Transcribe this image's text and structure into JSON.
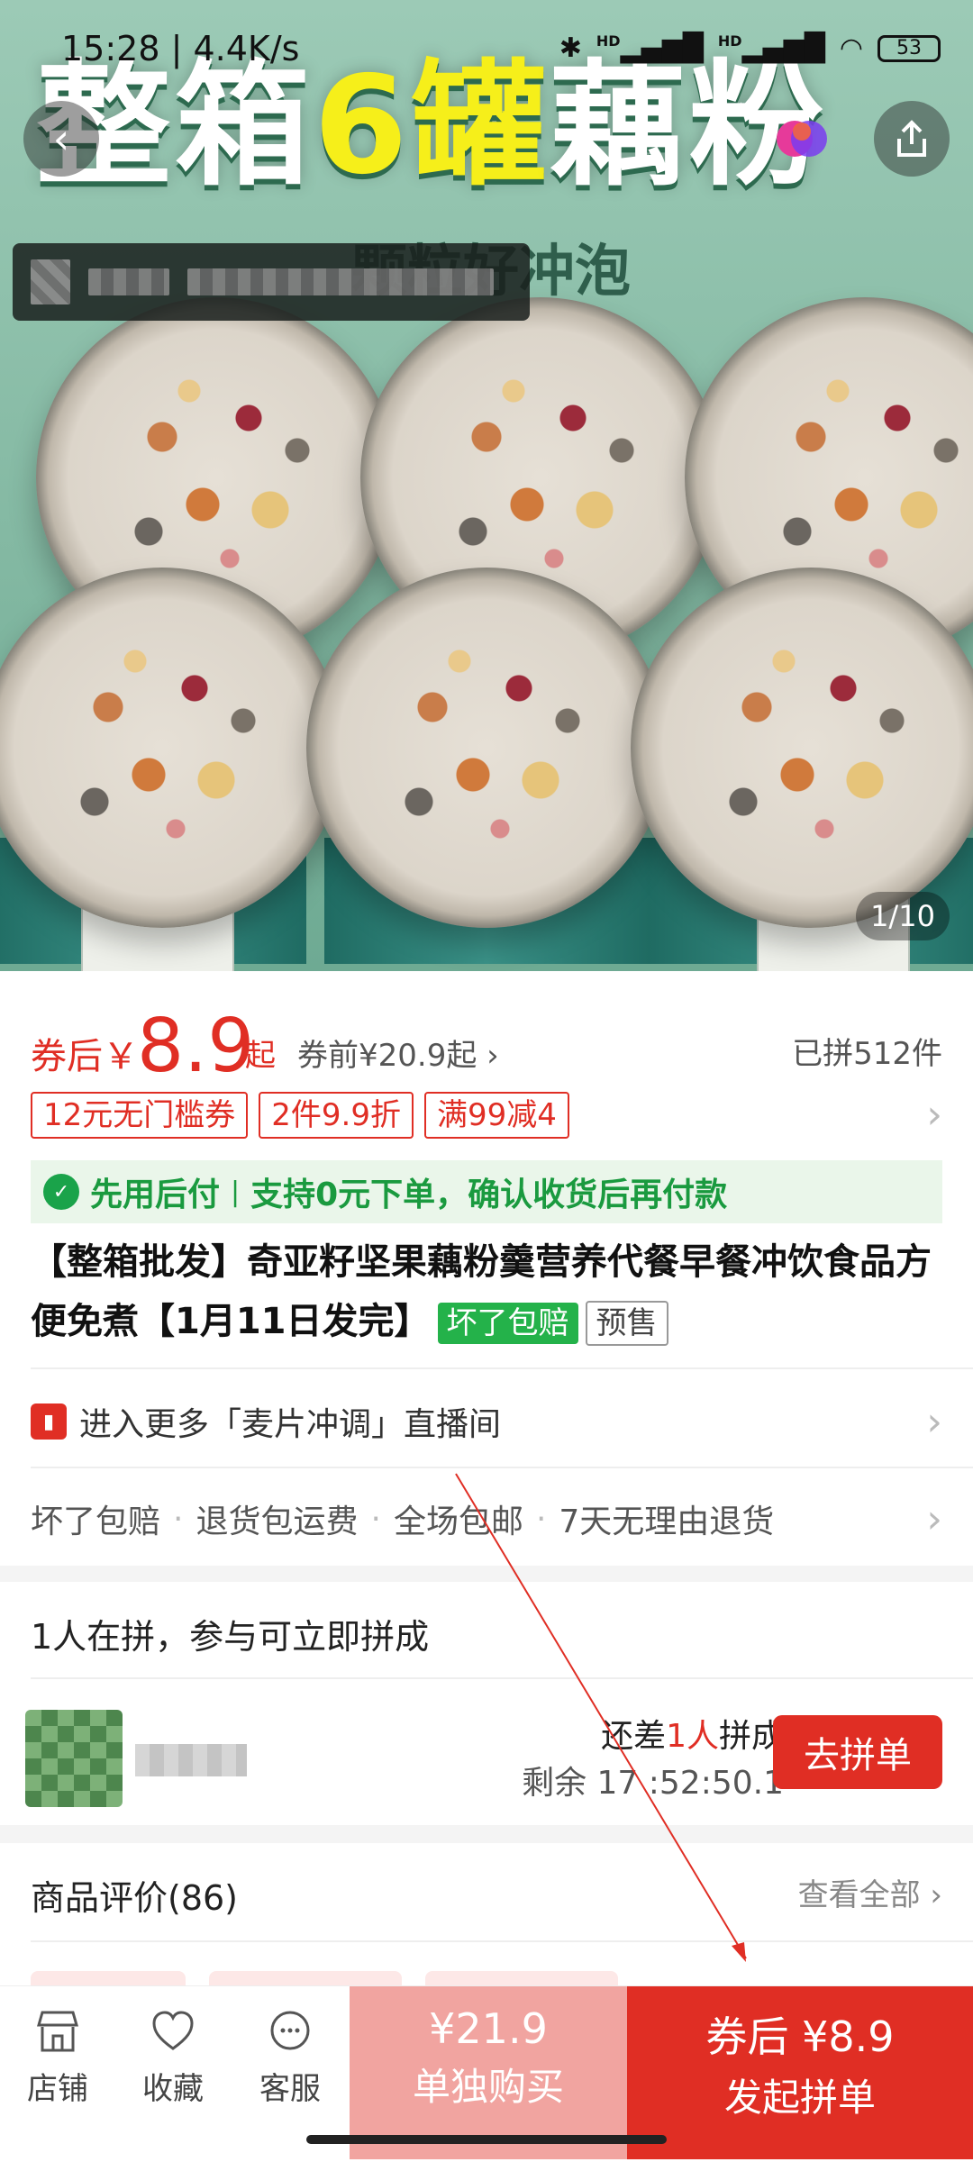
{
  "status_bar": {
    "time": "15:28 | 4.4K/s",
    "battery": "53"
  },
  "hero": {
    "title_part1": "整箱",
    "title_part2": "6罐",
    "title_part3": "藕粉",
    "subtitle": "颗粒好冲泡",
    "image_counter": "1/10"
  },
  "price": {
    "after_label": "券后￥",
    "value": "8.9",
    "qi": "起",
    "before": "券前¥20.9起 ›",
    "sold": "已拼512件"
  },
  "coupons": [
    "12元无门槛券",
    "2件9.9折",
    "满99减4"
  ],
  "pay_later": {
    "title": "先用后付",
    "desc": "支持0元下单，确认收货后再付款"
  },
  "product": {
    "title": "【整箱批发】奇亚籽坚果藕粉羹营养代餐早餐冲饮食品方便免煮【1月11日发完】",
    "tag_guarantee": "坏了包赔",
    "tag_presale": "预售"
  },
  "live": {
    "text": "进入更多「麦片冲调」直播间"
  },
  "services": [
    "坏了包赔",
    "退货包运费",
    "全场包邮",
    "7天无理由退货"
  ],
  "group": {
    "header": "1人在拼，参与可立即拼成",
    "short_prefix": "还差",
    "short_count": "1人",
    "short_suffix": "拼成",
    "remaining": "剩余 17 :52:50.1",
    "join_label": "去拼单"
  },
  "reviews": {
    "header": "商品评价(86)",
    "see_all": "查看全部 ›"
  },
  "bottom_bar": {
    "tabs": [
      {
        "label": "店铺",
        "icon": "store-icon"
      },
      {
        "label": "收藏",
        "icon": "heart-icon"
      },
      {
        "label": "客服",
        "icon": "chat-icon"
      }
    ],
    "solo_price": "¥21.9",
    "solo_label": "单独购买",
    "group_price": "券后 ¥8.9",
    "group_label": "发起拼单"
  },
  "colors": {
    "accent": "#e02e24",
    "green": "#1a9a3f",
    "solo_bg": "#f1a4a0"
  }
}
